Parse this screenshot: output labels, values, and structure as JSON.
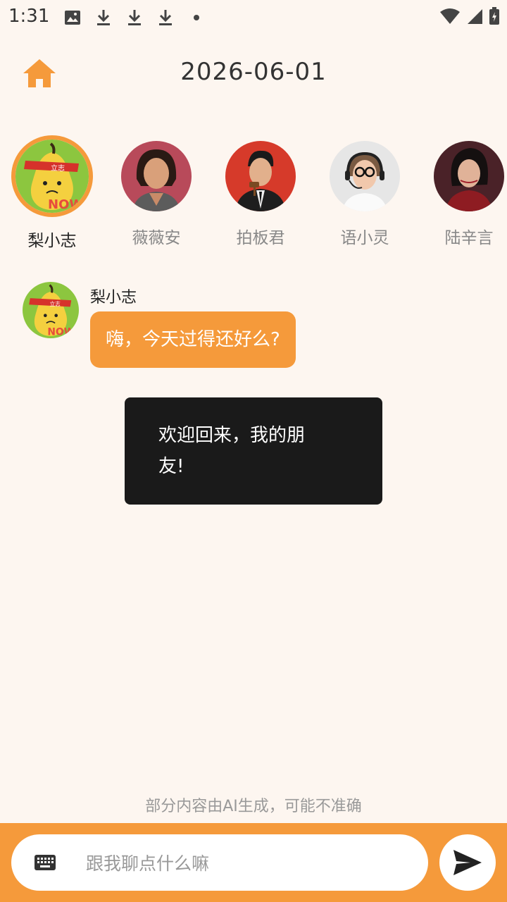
{
  "status_bar": {
    "time": "1:31",
    "icons_left": [
      "image-icon",
      "download-icon",
      "download-icon",
      "download-icon",
      "dot-icon"
    ],
    "icons_right": [
      "wifi-icon",
      "signal-icon",
      "battery-icon"
    ]
  },
  "header": {
    "home_icon": "home-icon",
    "date": "2026-06-01"
  },
  "characters": [
    {
      "name": "梨小志",
      "selected": true
    },
    {
      "name": "薇薇安",
      "selected": false
    },
    {
      "name": "拍板君",
      "selected": false
    },
    {
      "name": "语小灵",
      "selected": false
    },
    {
      "name": "陆辛言",
      "selected": false
    }
  ],
  "messages": [
    {
      "sender": "梨小志",
      "text": "嗨，今天过得还好么?"
    }
  ],
  "toast": {
    "text": "欢迎回来，我的朋友!"
  },
  "disclaimer": "部分内容由AI生成，可能不准确",
  "input": {
    "placeholder": "跟我聊点什么嘛",
    "value": "",
    "keyboard_icon": "keyboard-icon",
    "send_icon": "send-icon"
  },
  "colors": {
    "accent": "#f59a3b",
    "background": "#fdf6f0",
    "toast_bg": "#1a1a1a"
  }
}
